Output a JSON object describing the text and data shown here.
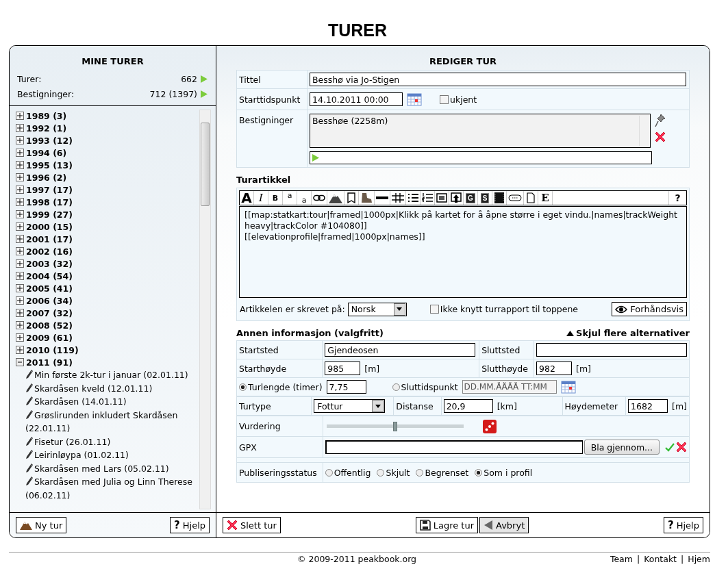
{
  "page_title": "TURER",
  "sidebar": {
    "title": "MINE TURER",
    "stats": [
      {
        "label": "Turer:",
        "value": "662"
      },
      {
        "label": "Bestigninger:",
        "value": "712 (1397)"
      }
    ],
    "tree": [
      {
        "label": "1989 (3)",
        "expanded": false
      },
      {
        "label": "1992 (1)",
        "expanded": false
      },
      {
        "label": "1993 (12)",
        "expanded": false
      },
      {
        "label": "1994 (6)",
        "expanded": false
      },
      {
        "label": "1995 (13)",
        "expanded": false
      },
      {
        "label": "1996 (2)",
        "expanded": false
      },
      {
        "label": "1997 (17)",
        "expanded": false
      },
      {
        "label": "1998 (17)",
        "expanded": false
      },
      {
        "label": "1999 (27)",
        "expanded": false
      },
      {
        "label": "2000 (15)",
        "expanded": false
      },
      {
        "label": "2001 (17)",
        "expanded": false
      },
      {
        "label": "2002 (16)",
        "expanded": false
      },
      {
        "label": "2003 (32)",
        "expanded": false
      },
      {
        "label": "2004 (54)",
        "expanded": false
      },
      {
        "label": "2005 (41)",
        "expanded": false
      },
      {
        "label": "2006 (34)",
        "expanded": false
      },
      {
        "label": "2007 (32)",
        "expanded": false
      },
      {
        "label": "2008 (52)",
        "expanded": false
      },
      {
        "label": "2009 (61)",
        "expanded": false
      },
      {
        "label": "2010 (119)",
        "expanded": false
      },
      {
        "label": "2011 (91)",
        "expanded": true,
        "children": [
          {
            "label": "Min første 2k-tur i januar (02.01.11)"
          },
          {
            "label": "Skardåsen kveld (12.01.11)"
          },
          {
            "label": "Skardåsen (14.01.11)"
          },
          {
            "label": "Grøslirunden inkludert Skardåsen (22.01.11)"
          },
          {
            "label": "Fisetur (26.01.11)"
          },
          {
            "label": "Leirinløypa (01.02.11)"
          },
          {
            "label": "Skardåsen med Lars (05.02.11)"
          },
          {
            "label": "Skardåsen med Julia og Linn Therese (06.02.11)"
          }
        ]
      }
    ],
    "buttons": [
      {
        "kind": "new",
        "label": "Ny tur"
      },
      {
        "kind": "help",
        "icon": "?",
        "label": "Hjelp"
      }
    ]
  },
  "editor": {
    "title": "REDIGER TUR",
    "title_label": "Tittel",
    "title_value": "Besshø via Jo-Stigen",
    "start_label": "Starttidspunkt",
    "start_value": "14.10.2011 00:00",
    "unknown": {
      "label": "ukjent",
      "checked": false
    },
    "summits_label": "Bestigninger",
    "summits": [
      "Besshøe (2258m)"
    ],
    "article_heading": "Turartikkel",
    "toolbar": [
      {
        "kind": "bigletter",
        "label": "A"
      },
      {
        "kind": "italic",
        "label": "I"
      },
      {
        "kind": "bold",
        "label": "B"
      },
      {
        "kind": "sup",
        "label": "a"
      },
      {
        "kind": "sub",
        "label": "a"
      },
      {
        "kind": "link"
      },
      {
        "kind": "mountain"
      },
      {
        "kind": "page"
      },
      {
        "kind": "boot"
      },
      {
        "kind": "rule"
      },
      {
        "kind": "grid"
      },
      {
        "kind": "bullets"
      },
      {
        "kind": "numbers"
      },
      {
        "kind": "image"
      },
      {
        "kind": "upload"
      },
      {
        "kind": "dark",
        "label": "G"
      },
      {
        "kind": "dark",
        "label": "S"
      },
      {
        "kind": "film"
      },
      {
        "kind": "chain"
      },
      {
        "kind": "doc"
      },
      {
        "kind": "serif",
        "label": "E"
      },
      {
        "kind": "help",
        "label": "?"
      }
    ],
    "article_text": "[[map:statkart:tour|framed|1000px|Klikk på kartet for å åpne større i eget vindu.|names|trackWeight heavy|trackColor #104080]]\n[[elevationprofile|framed|1000px|names]]",
    "language_label": "Artikkelen er skrevet på:",
    "language": "Norsk",
    "no_link": {
      "label": "Ikke knytt turrapport til toppene",
      "checked": false
    },
    "preview": "Forhåndsvis",
    "other_heading": "Annen informasjon (valgfritt)",
    "hide_link": "Skjul flere alternativer",
    "start_place_label": "Startsted",
    "start_place": "Gjendeosen",
    "end_place_label": "Sluttsted",
    "start_alt_label": "Starthøyde",
    "start_alt": "985",
    "start_alt_unit": "[m]",
    "end_alt_label": "Slutthøyde",
    "end_alt": "982",
    "end_alt_unit": "[m]",
    "duration": [
      {
        "label": "Turlengde (timer)",
        "selected": true,
        "value": "7,75"
      },
      {
        "label": "Sluttidspunkt",
        "selected": false,
        "placeholder": "DD.MM.ÅÅÅÅ TT:MM"
      }
    ],
    "type_label": "Turtype",
    "type": "Fottur",
    "distance_label": "Distanse",
    "distance": "20,9",
    "distance_unit": "[km]",
    "ascent_label": "Høydemeter",
    "ascent": "1682",
    "ascent_unit": "[m]",
    "rating_label": "Vurdering",
    "rating": {
      "level": 0.5
    },
    "gpx_label": "GPX",
    "browse": "Bla gjennom...",
    "publish_label": "Publiseringsstatus",
    "publish": [
      {
        "label": "Offentlig",
        "selected": false
      },
      {
        "label": "Skjult",
        "selected": false
      },
      {
        "label": "Begrenset",
        "selected": false
      },
      {
        "label": "Som i profil",
        "selected": true
      }
    ],
    "buttons": [
      {
        "kind": "delete",
        "label": "Slett tur"
      },
      {
        "kind": "save",
        "label": "Lagre tur"
      },
      {
        "kind": "cancel",
        "label": "Avbryt"
      },
      {
        "kind": "help",
        "icon": "?",
        "label": "Hjelp"
      }
    ]
  },
  "footer": {
    "copyright": "© 2009-2011 peakbook.org",
    "links": [
      "Team",
      "Kontakt",
      "Hjem"
    ],
    "separator": "|"
  }
}
